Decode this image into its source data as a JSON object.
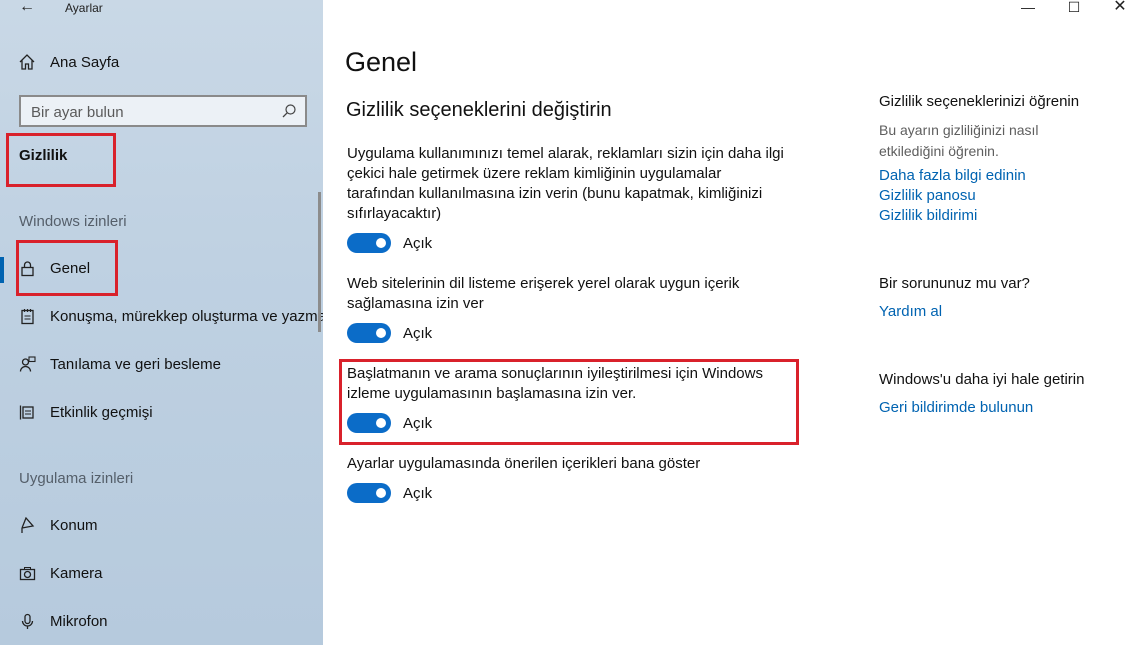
{
  "window": {
    "app_title": "Ayarlar",
    "minimize_icon": "minimize-icon",
    "maximize_icon": "maximize-icon",
    "close_icon": "close-icon"
  },
  "sidebar": {
    "home_label": "Ana Sayfa",
    "search_placeholder": "Bir ayar bulun",
    "current_section": "Gizlilik",
    "windows_permissions_header": "Windows izinleri",
    "windows_items": [
      {
        "label": "Genel",
        "icon": "lock-icon",
        "active": true
      },
      {
        "label": "Konuşma, mürekkep oluşturma ve yazma",
        "icon": "notepad-icon"
      },
      {
        "label": "Tanılama ve geri besleme",
        "icon": "person-feedback-icon"
      },
      {
        "label": "Etkinlik geçmişi",
        "icon": "activity-icon"
      }
    ],
    "app_permissions_header": "Uygulama izinleri",
    "app_items": [
      {
        "label": "Konum",
        "icon": "location-icon"
      },
      {
        "label": "Kamera",
        "icon": "camera-icon"
      },
      {
        "label": "Mikrofon",
        "icon": "microphone-icon"
      }
    ]
  },
  "main": {
    "page_title": "Genel",
    "section_title": "Gizlilik seçeneklerini değiştirin",
    "settings": [
      {
        "text": "Uygulama kullanımınızı temel alarak, reklamları sizin için daha ilgi çekici hale getirmek üzere reklam kimliğinin uygulamalar tarafından kullanılmasına izin verin (bunu kapatmak, kimliğinizi sıfırlayacaktır)",
        "state": "Açık"
      },
      {
        "text": "Web sitelerinin dil listeme erişerek yerel olarak uygun içerik sağlamasına izin ver",
        "state": "Açık"
      },
      {
        "text": "Başlatmanın ve arama sonuçlarının iyileştirilmesi için Windows izleme uygulamasının başlamasına izin ver.",
        "state": "Açık"
      },
      {
        "text": "Ayarlar uygulamasında önerilen içerikleri bana göster",
        "state": "Açık"
      }
    ]
  },
  "side_panel": {
    "learn_heading": "Gizlilik seçeneklerinizi öğrenin",
    "learn_text": "Bu ayarın gizliliğinizi nasıl etkilediğini öğrenin.",
    "links": [
      "Daha fazla bilgi edinin",
      "Gizlilik panosu",
      "Gizlilik bildirimi"
    ],
    "question_heading": "Bir sorununuz mu var?",
    "help_link": "Yardım al",
    "improve_heading": "Windows'u daha iyi hale getirin",
    "feedback_link": "Geri bildirimde bulunun"
  },
  "colors": {
    "accent": "#0063b1",
    "toggle_on": "#0b6cc8",
    "highlight_box": "#d9212b"
  }
}
